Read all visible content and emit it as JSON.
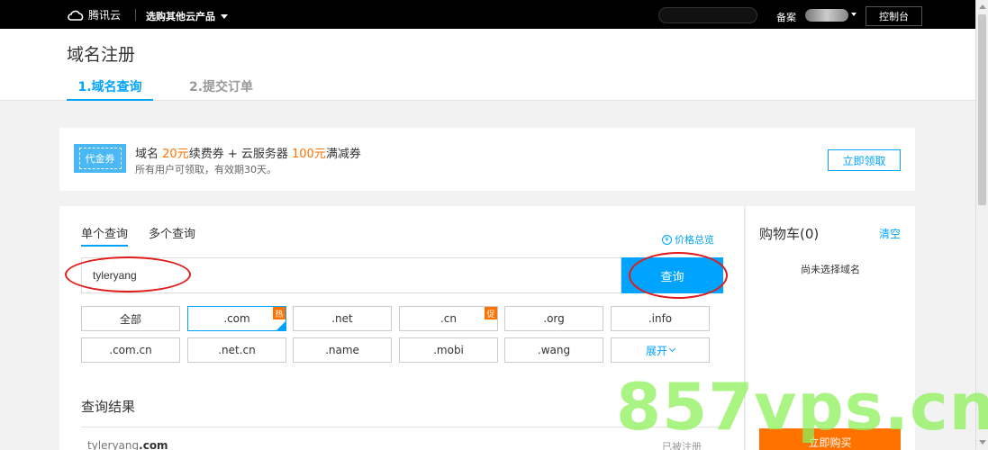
{
  "topbar": {
    "logo_text": "腾讯云",
    "products_label": "选购其他云产品",
    "beian_label": "备案",
    "console_label": "控制台"
  },
  "header": {
    "title": "域名注册",
    "steps": [
      "1.域名查询",
      "2.提交订单"
    ]
  },
  "promo": {
    "coupon_label": "代金券",
    "line1_a": "域名 ",
    "line1_amount1": "20元",
    "line1_b": "续费券 + 云服务器 ",
    "line1_amount2": "100元",
    "line1_c": "满减券",
    "line2": "所有用户可领取，有效期30天。",
    "claim_label": "立即领取"
  },
  "search": {
    "tabs": [
      "单个查询",
      "多个查询"
    ],
    "price_overview": "价格总览",
    "input_value": "tyleryang",
    "button_label": "查询"
  },
  "tlds": [
    {
      "label": "全部",
      "badge": ""
    },
    {
      "label": ".com",
      "badge": "热",
      "selected": true
    },
    {
      "label": ".net",
      "badge": ""
    },
    {
      "label": ".cn",
      "badge": "促"
    },
    {
      "label": ".org",
      "badge": ""
    },
    {
      "label": ".info",
      "badge": ""
    },
    {
      "label": ".com.cn",
      "badge": ""
    },
    {
      "label": ".net.cn",
      "badge": ""
    },
    {
      "label": ".name",
      "badge": ""
    },
    {
      "label": ".mobi",
      "badge": ""
    },
    {
      "label": ".wang",
      "badge": ""
    },
    {
      "label": "展开",
      "badge": "",
      "expand": true
    }
  ],
  "results": {
    "title": "查询结果",
    "rows": [
      {
        "domain_name": "tyleryang",
        "domain_tld": ".com",
        "status": "已被注册"
      }
    ]
  },
  "cart": {
    "title": "购物车(0)",
    "clear_label": "清空",
    "empty_text": "尚未选择域名",
    "buy_label": "立即购买"
  },
  "watermark_text": "857vps.cn"
}
